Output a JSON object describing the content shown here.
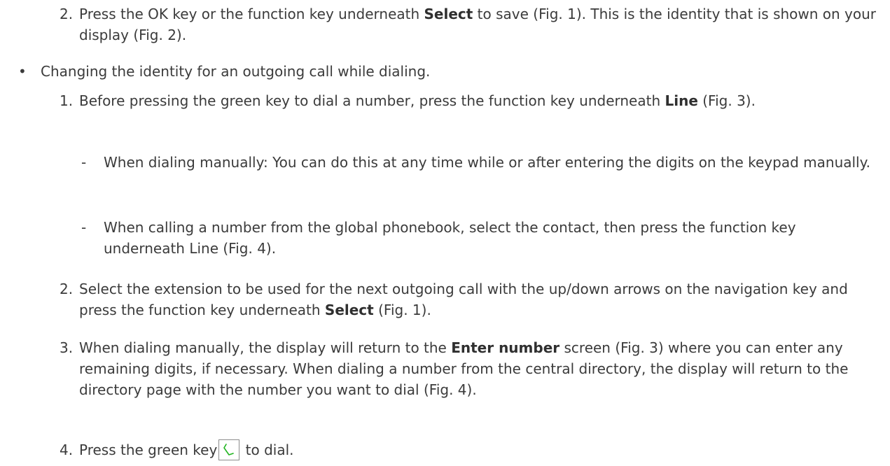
{
  "items": {
    "step2_top": {
      "num": "2.",
      "t1": "Press the OK key or the function key underneath ",
      "b1": "Select",
      "t2": " to save (Fig. 1).  This is the identity that is shown on your display (Fig. 2)."
    },
    "bullet": {
      "mark": "•",
      "text": "Changing the identity for an outgoing call while dialing."
    },
    "s1": {
      "num": "1.",
      "t1": "Before pressing the green key to dial a number, press the function key underneath ",
      "b1": "Line",
      "t2": " (Fig. 3)."
    },
    "d1": {
      "mark": "-",
      "text": "When dialing manually:  You can do this at any time while or after entering the digits on the keypad manually."
    },
    "d2": {
      "mark": "-",
      "text": "When calling a number from the global phonebook, select the contact, then press the function key underneath Line (Fig. 4)."
    },
    "s2": {
      "num": "2.",
      "t1": "Select the extension to be used for the next outgoing call with the up/down arrows on the navigation key and press the function key underneath ",
      "b1": "Select",
      "t2": " (Fig. 1)."
    },
    "s3": {
      "num": "3.",
      "t1": "When dialing manually, the display will return to the ",
      "b1": "Enter number",
      "t2": " screen (Fig. 3) where you can enter any remaining digits, if necessary.  When dialing a number from the central directory, the display will return to the directory page with the number you want to dial (Fig. 4)."
    },
    "s4": {
      "num": "4.",
      "t1": "Press the green key",
      "t2": " to dial.",
      "icon": "green-call-key-icon",
      "icon_color": "#22b521"
    }
  }
}
